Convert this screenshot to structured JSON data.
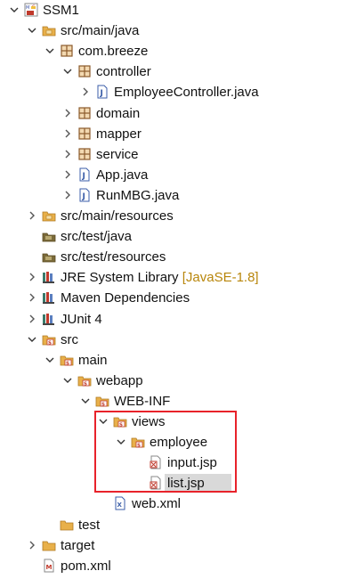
{
  "tree": [
    {
      "label": "SSM1",
      "depth": 0,
      "expand": "open",
      "icon": "maven-project-icon"
    },
    {
      "label": "src/main/java",
      "depth": 1,
      "expand": "open",
      "icon": "source-folder-icon"
    },
    {
      "label": "com.breeze",
      "depth": 2,
      "expand": "open",
      "icon": "package-icon"
    },
    {
      "label": "controller",
      "depth": 3,
      "expand": "open",
      "icon": "package-icon"
    },
    {
      "label": "EmployeeController.java",
      "depth": 4,
      "expand": "closed",
      "icon": "java-file-icon"
    },
    {
      "label": "domain",
      "depth": 3,
      "expand": "closed",
      "icon": "package-icon"
    },
    {
      "label": "mapper",
      "depth": 3,
      "expand": "closed",
      "icon": "package-icon"
    },
    {
      "label": "service",
      "depth": 3,
      "expand": "closed",
      "icon": "package-icon"
    },
    {
      "label": "App.java",
      "depth": 3,
      "expand": "closed",
      "icon": "java-file-icon"
    },
    {
      "label": "RunMBG.java",
      "depth": 3,
      "expand": "closed",
      "icon": "java-file-icon"
    },
    {
      "label": "src/main/resources",
      "depth": 1,
      "expand": "closed",
      "icon": "source-folder-icon"
    },
    {
      "label": "src/test/java",
      "depth": 1,
      "expand": "none",
      "icon": "source-folder-empty-icon"
    },
    {
      "label": "src/test/resources",
      "depth": 1,
      "expand": "none",
      "icon": "source-folder-empty-icon"
    },
    {
      "label": "JRE System Library",
      "decoration": "[JavaSE-1.8]",
      "depth": 1,
      "expand": "closed",
      "icon": "library-icon"
    },
    {
      "label": "Maven Dependencies",
      "depth": 1,
      "expand": "closed",
      "icon": "library-icon"
    },
    {
      "label": "JUnit 4",
      "depth": 1,
      "expand": "closed",
      "icon": "library-icon"
    },
    {
      "label": "src",
      "depth": 1,
      "expand": "open",
      "icon": "folder-icon"
    },
    {
      "label": "main",
      "depth": 2,
      "expand": "open",
      "icon": "folder-icon"
    },
    {
      "label": "webapp",
      "depth": 3,
      "expand": "open",
      "icon": "folder-icon"
    },
    {
      "label": "WEB-INF",
      "depth": 4,
      "expand": "open",
      "icon": "folder-icon"
    },
    {
      "label": "views",
      "depth": 5,
      "expand": "open",
      "icon": "folder-icon"
    },
    {
      "label": "employee",
      "depth": 6,
      "expand": "open",
      "icon": "folder-icon"
    },
    {
      "label": "input.jsp",
      "depth": 7,
      "expand": "none",
      "icon": "jsp-file-icon"
    },
    {
      "label": "list.jsp",
      "depth": 7,
      "expand": "none",
      "icon": "jsp-file-icon",
      "selected": true
    },
    {
      "label": "web.xml",
      "depth": 5,
      "expand": "none",
      "icon": "xml-file-icon"
    },
    {
      "label": "test",
      "depth": 2,
      "expand": "none",
      "icon": "folder-plain-icon"
    },
    {
      "label": "target",
      "depth": 1,
      "expand": "closed",
      "icon": "folder-plain-icon"
    },
    {
      "label": "pom.xml",
      "depth": 1,
      "expand": "none",
      "icon": "maven-pom-icon"
    }
  ],
  "colors": {
    "highlight_border": "#e8222a",
    "selection": "#d9d9d9",
    "decoration": "#b8860b",
    "folder": "#e8b04a",
    "package": "#8b5a2b",
    "java": "#3b5ea8"
  }
}
